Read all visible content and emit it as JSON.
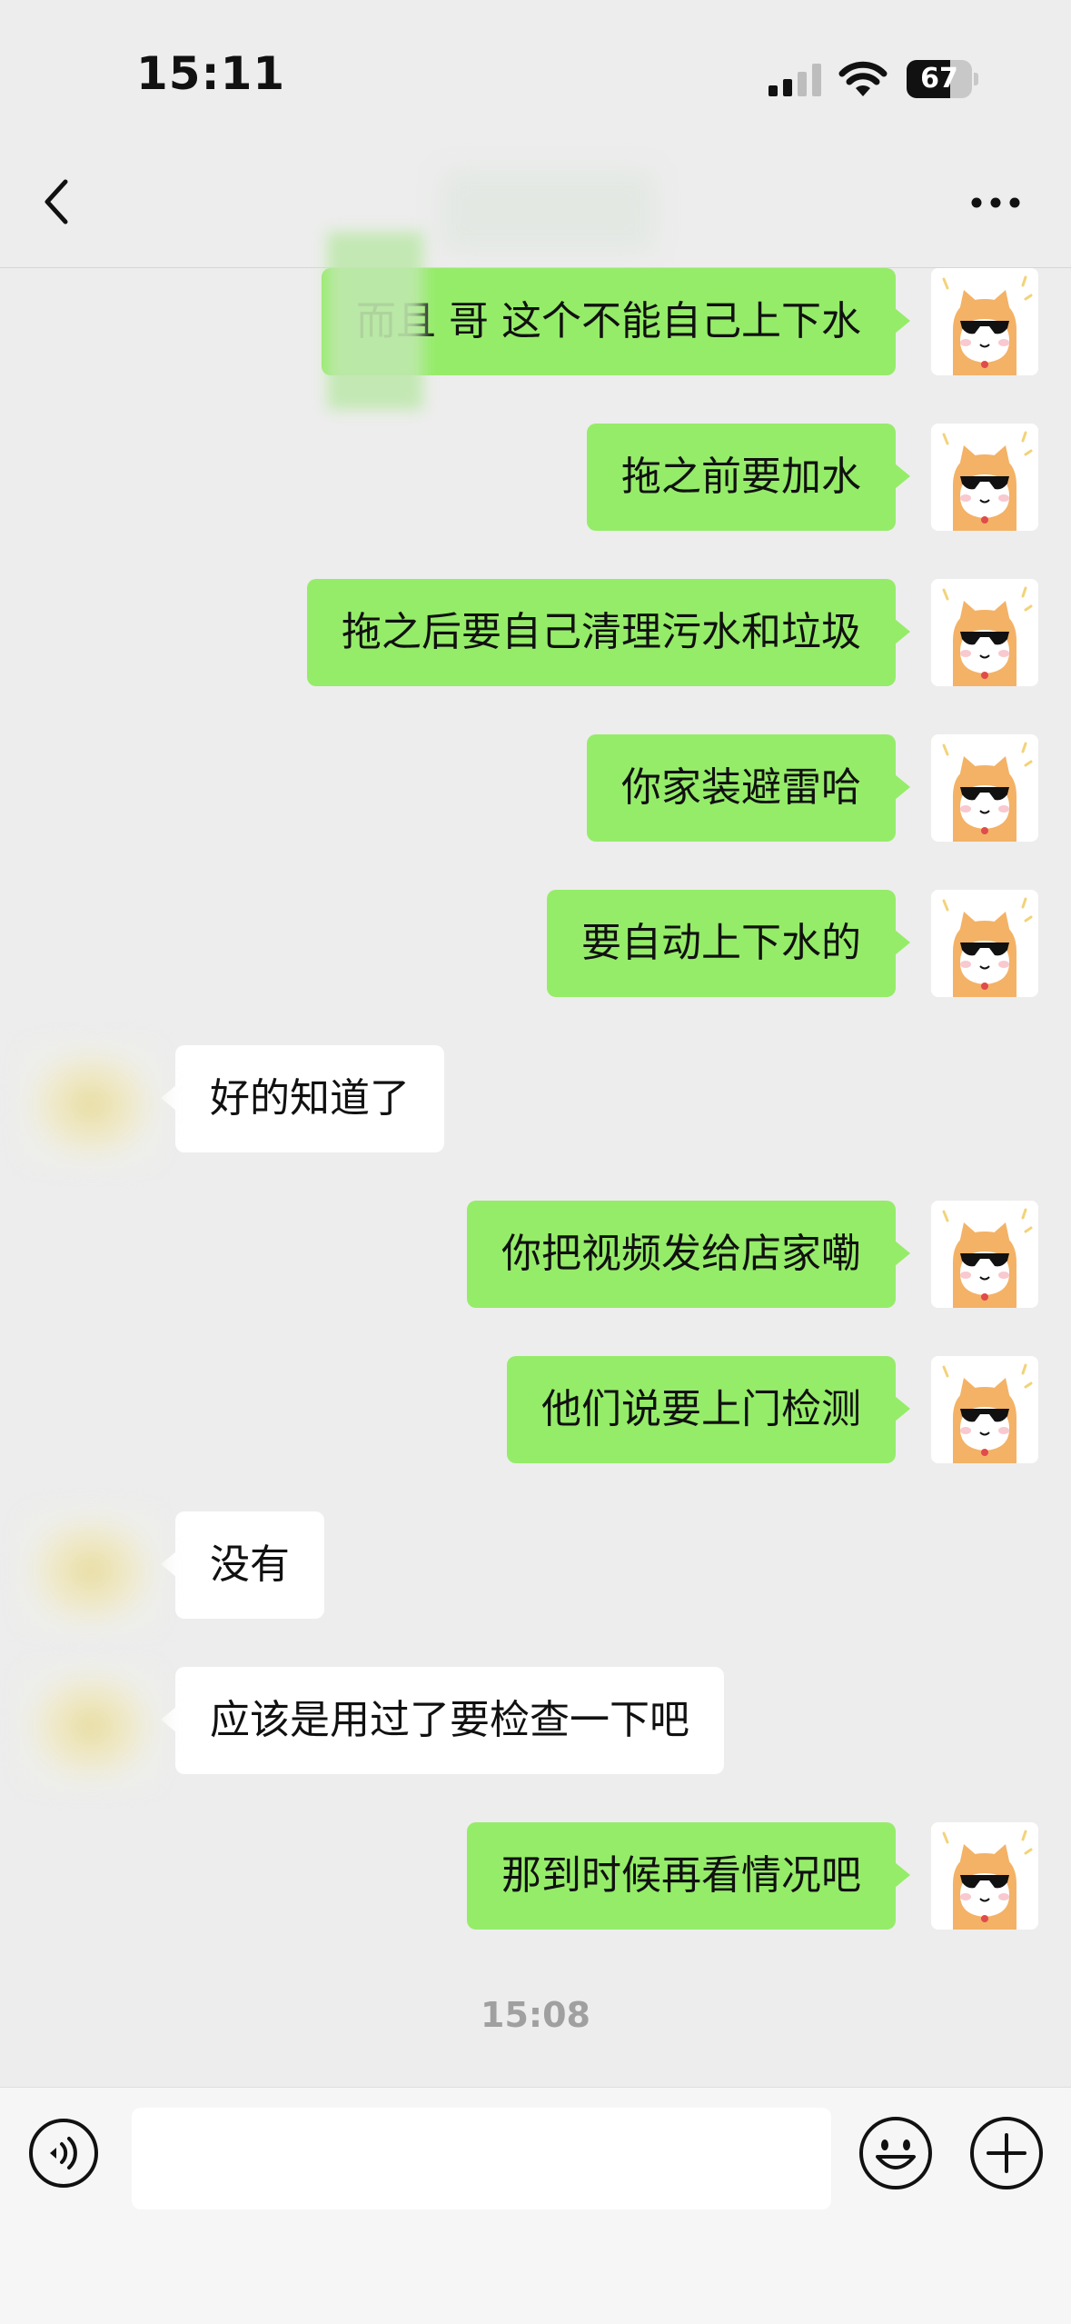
{
  "status_bar": {
    "time": "15:11",
    "battery": "67",
    "battery_level": 0.67
  },
  "header": {
    "title": "",
    "back_icon": "chevron-left-icon",
    "more_icon": "more-horizontal-icon"
  },
  "messages": [
    {
      "side": "out",
      "text": "而且 哥 这个不能自己上下水"
    },
    {
      "side": "out",
      "text": "拖之前要加水"
    },
    {
      "side": "out",
      "text": "拖之后要自己清理污水和垃圾"
    },
    {
      "side": "out",
      "text": "你家装避雷哈"
    },
    {
      "side": "out",
      "text": "要自动上下水的"
    },
    {
      "side": "in",
      "text": "好的知道了"
    },
    {
      "side": "out",
      "text": "你把视频发给店家嘞"
    },
    {
      "side": "out",
      "text": "他们说要上门检测"
    },
    {
      "side": "in",
      "text": "没有"
    },
    {
      "side": "in",
      "text": "应该是用过了要检查一下吧"
    },
    {
      "side": "out",
      "text": "那到时候再看情况吧"
    }
  ],
  "timestamp": "15:08",
  "input_bar": {
    "placeholder": "",
    "voice_icon": "voice-icon",
    "emoji_icon": "emoji-icon",
    "plus_icon": "plus-icon"
  },
  "colors": {
    "outgoing_bubble": "#95ec69",
    "incoming_bubble": "#ffffff",
    "background": "#ededed"
  }
}
